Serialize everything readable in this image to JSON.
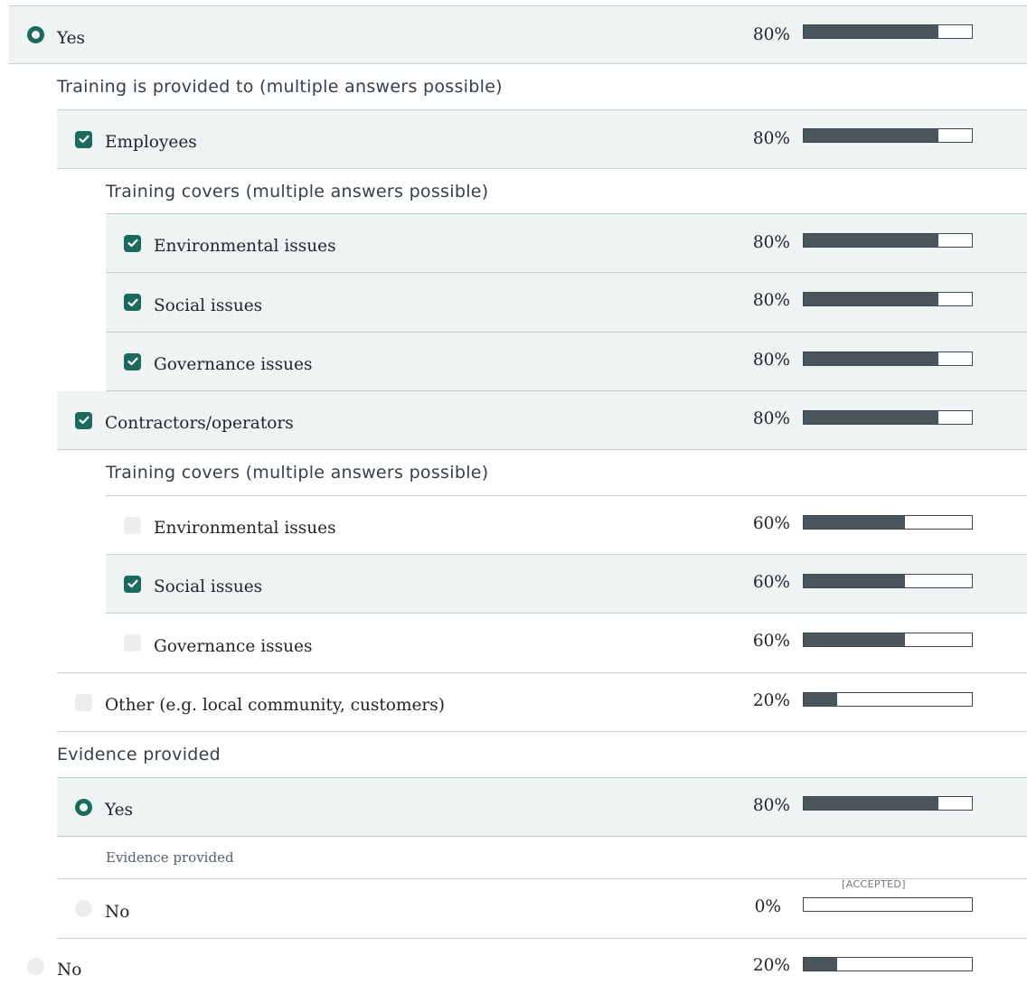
{
  "top_option": {
    "label": "Yes",
    "percent_text": "80%",
    "percent": 80
  },
  "training_provided": {
    "heading": "Training is provided to (multiple answers possible)",
    "employees": {
      "label": "Employees",
      "percent_text": "80%",
      "percent": 80,
      "covers_heading": "Training covers (multiple answers possible)",
      "items": [
        {
          "label": "Environmental issues",
          "percent_text": "80%",
          "percent": 80,
          "checked": true
        },
        {
          "label": "Social issues",
          "percent_text": "80%",
          "percent": 80,
          "checked": true
        },
        {
          "label": "Governance issues",
          "percent_text": "80%",
          "percent": 80,
          "checked": true
        }
      ]
    },
    "contractors": {
      "label": "Contractors/operators",
      "percent_text": "80%",
      "percent": 80,
      "covers_heading": "Training covers (multiple answers possible)",
      "items": [
        {
          "label": "Environmental issues",
          "percent_text": "60%",
          "percent": 60,
          "checked": false
        },
        {
          "label": "Social issues",
          "percent_text": "60%",
          "percent": 60,
          "checked": true
        },
        {
          "label": "Governance issues",
          "percent_text": "60%",
          "percent": 60,
          "checked": false
        }
      ]
    },
    "other": {
      "label": "Other (e.g. local community, customers)",
      "percent_text": "20%",
      "percent": 20
    }
  },
  "evidence": {
    "heading": "Evidence provided",
    "yes": {
      "label": "Yes",
      "percent_text": "80%",
      "percent": 80
    },
    "note": "Evidence provided",
    "no": {
      "label": "No",
      "percent_text": "0%",
      "percent": 0,
      "badge": "[ACCEPTED]"
    }
  },
  "bottom_option": {
    "label": "No",
    "percent_text": "20%",
    "percent": 20
  },
  "colors": {
    "accent": "#1c6a5b",
    "selected_bg": "#eef4f3",
    "bar_fill": "#4b555c"
  }
}
